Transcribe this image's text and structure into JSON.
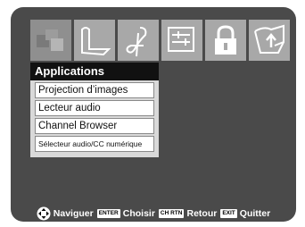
{
  "icon_tabs": [
    {
      "icon": "puzzle-pieces-icon",
      "active": true
    },
    {
      "icon": "picture-icon",
      "active": false
    },
    {
      "icon": "music-note-icon",
      "active": false
    },
    {
      "icon": "sliders-icon",
      "active": false
    },
    {
      "icon": "lock-icon",
      "active": false
    },
    {
      "icon": "setup-icon",
      "active": false
    }
  ],
  "menu": {
    "title": "Applications",
    "items": [
      "Projection d’images",
      "Lecteur audio",
      "Channel Browser",
      "Sélecteur audio/CC numérique"
    ]
  },
  "footer": {
    "navigate_label": "Naviguer",
    "enter_key": "ENTER",
    "choose_label": "Choisir",
    "ch_rtn_key": "CH RTN",
    "return_label": "Retour",
    "exit_key": "EXIT",
    "quit_label": "Quitter"
  },
  "colors": {
    "background": "#4a4a4a",
    "icon_tab": "#a8a8a8",
    "menu_header": "#111111"
  }
}
